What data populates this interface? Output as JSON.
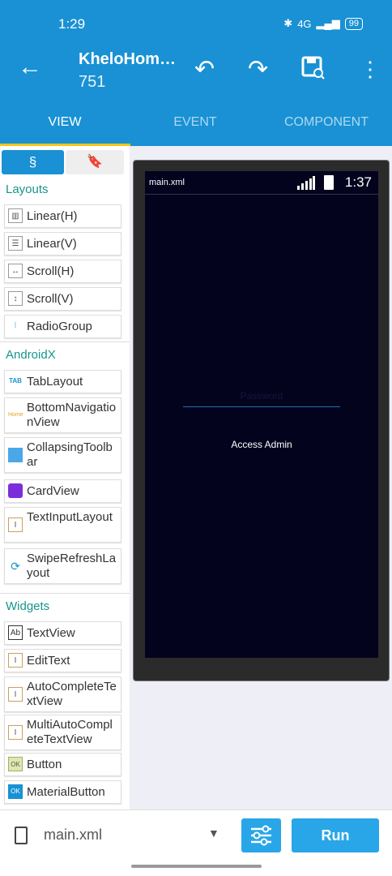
{
  "status_bar": {
    "time": "1:29",
    "network": "4G",
    "battery": "99"
  },
  "app_bar": {
    "title": "KheloHom…",
    "subtitle": "751"
  },
  "tabs": [
    {
      "label": "VIEW",
      "active": true
    },
    {
      "label": "EVENT",
      "active": false
    },
    {
      "label": "COMPONENT",
      "active": false
    }
  ],
  "palette": {
    "sections": [
      {
        "title": "Layouts",
        "items": [
          "Linear(H)",
          "Linear(V)",
          "Scroll(H)",
          "Scroll(V)",
          "RadioGroup"
        ]
      },
      {
        "title": "AndroidX",
        "items": [
          "TabLayout",
          "BottomNavigationView",
          "CollapsingToolbar",
          "CardView",
          "TextInputLayout",
          "SwipeRefreshLayout"
        ]
      },
      {
        "title": "Widgets",
        "items": [
          "TextView",
          "EditText",
          "AutoCompleteTextView",
          "MultiAutoCompleteTextView",
          "Button",
          "MaterialButton"
        ]
      }
    ],
    "icon_labels": {
      "tab": "TAB",
      "home": "Home",
      "textview": "Ab",
      "button": "OK"
    }
  },
  "preview": {
    "file": "main.xml",
    "time": "1:37",
    "password_hint": "Password",
    "admin_text": "Access Admin"
  },
  "bottom_bar": {
    "file": "main.xml",
    "run_label": "Run"
  },
  "colors": {
    "primary": "#1991d4",
    "accent": "#f7c51a",
    "section": "#16968a",
    "screen_bg": "#03031e",
    "button": "#29a6e8"
  }
}
